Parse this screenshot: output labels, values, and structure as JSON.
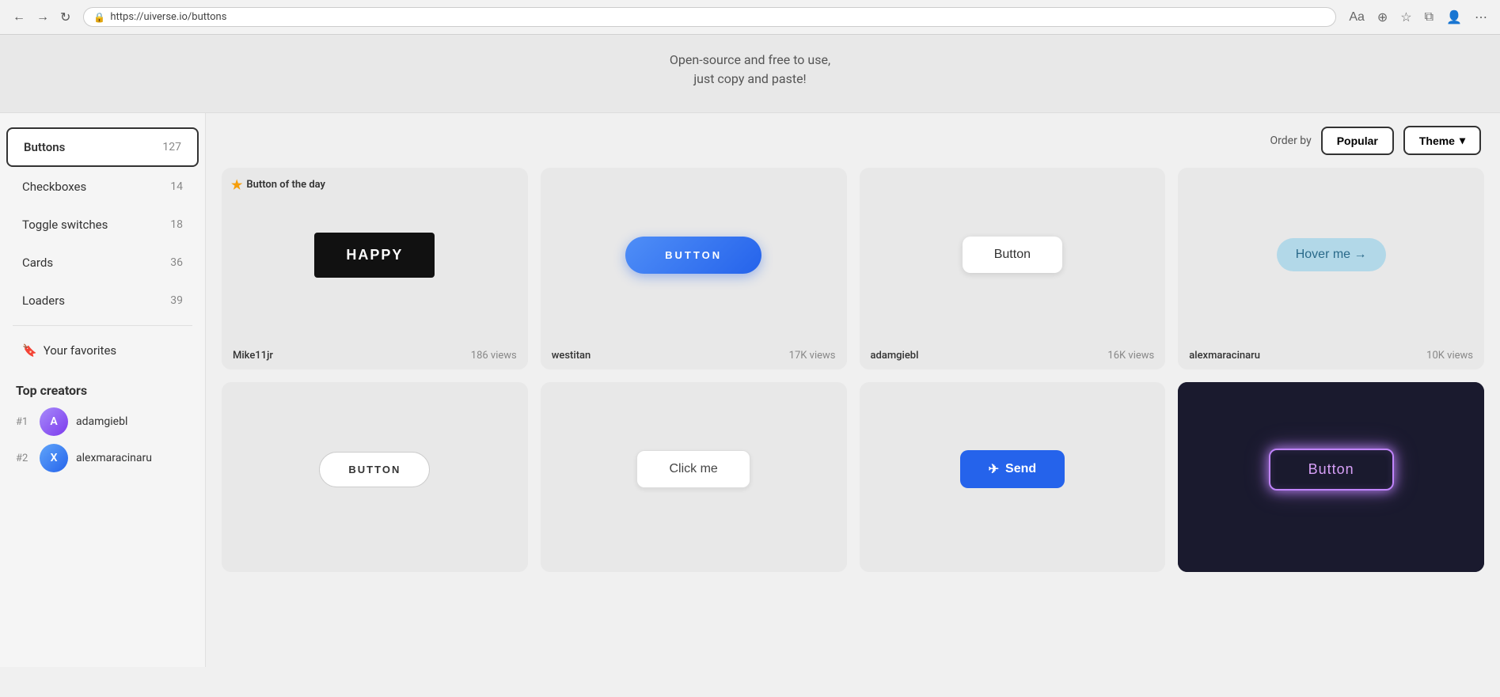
{
  "browser": {
    "url": "https://uiverse.io/buttons",
    "back_label": "←",
    "forward_label": "→",
    "reload_label": "↻"
  },
  "hero": {
    "subtitle": "Open-source and free to use,",
    "subtitle2": "just copy and paste!"
  },
  "order_by": {
    "label": "Order by",
    "popular_label": "Popular",
    "theme_label": "Theme",
    "chevron": "▾"
  },
  "sidebar": {
    "items": [
      {
        "label": "Buttons",
        "count": "127",
        "active": true
      },
      {
        "label": "Checkboxes",
        "count": "14",
        "active": false
      },
      {
        "label": "Toggle switches",
        "count": "18",
        "active": false
      },
      {
        "label": "Cards",
        "count": "36",
        "active": false
      },
      {
        "label": "Loaders",
        "count": "39",
        "active": false
      }
    ],
    "favorites_label": "Your favorites",
    "favorites_icon": "🔖",
    "top_creators_label": "Top creators",
    "creators": [
      {
        "rank": "#1",
        "name": "adamgiebl",
        "initials": "A"
      },
      {
        "rank": "#2",
        "name": "alexmaracinaru",
        "initials": "X"
      }
    ]
  },
  "cards": [
    {
      "badge": "Button of the day",
      "button_text": "HAPPY",
      "author": "Mike11jr",
      "views": "186 views",
      "style": "happy"
    },
    {
      "badge": "",
      "button_text": "BUTTON",
      "author": "westitan",
      "views": "17K views",
      "style": "blue-pill"
    },
    {
      "badge": "",
      "button_text": "Button",
      "author": "adamgiebl",
      "views": "16K views",
      "style": "plain"
    },
    {
      "badge": "",
      "button_text": "Hover me →",
      "author": "alexmaracinaru",
      "views": "10K views",
      "style": "hover"
    },
    {
      "badge": "",
      "button_text": "BUTTON",
      "author": "",
      "views": "",
      "style": "outline"
    },
    {
      "badge": "",
      "button_text": "Click me",
      "author": "",
      "views": "",
      "style": "click-me"
    },
    {
      "badge": "",
      "button_text": "Send",
      "author": "",
      "views": "",
      "style": "send"
    },
    {
      "badge": "",
      "button_text": "Button",
      "author": "",
      "views": "",
      "style": "neon",
      "dark": true
    }
  ]
}
